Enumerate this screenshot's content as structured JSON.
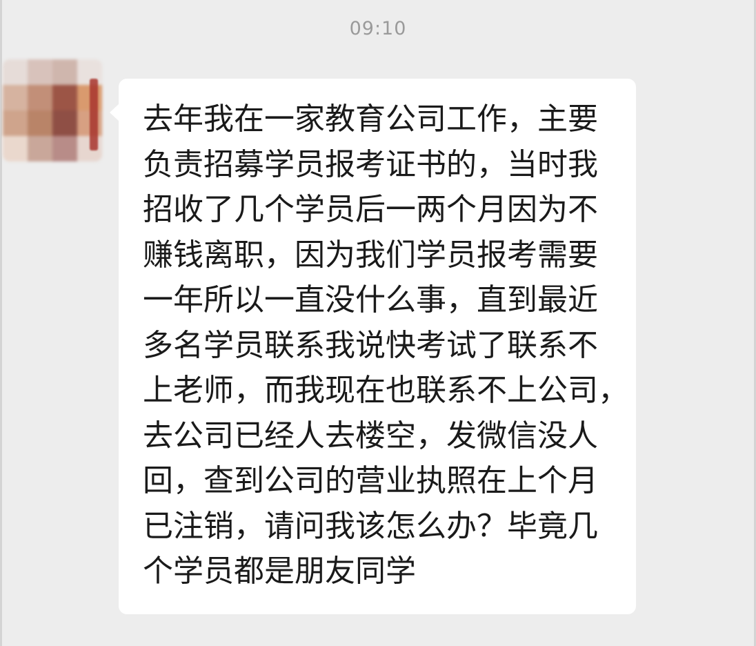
{
  "chat": {
    "timestamp": "09:10",
    "message": {
      "lines": [
        "去年我在一家教育公司工作，主要",
        "负责招募学员报考证书的，当时我",
        "招收了几个学员后一两个月因为不",
        "赚钱离职，因为我们学员报考需要",
        "一年所以一直没什么事，直到最近",
        "多名学员联系我说快考试了联系不",
        "上老师，而我现在也联系不上公司，",
        "去公司已经人去楼空，发微信没人",
        "回，查到公司的营业执照在上个月",
        "已注销，请问我该怎么办？毕竟几",
        "个学员都是朋友同学"
      ]
    },
    "avatar": {
      "icon": "blurred-avatar-icon",
      "mosaic_colors": [
        "#e6dcd8",
        "#d8c2bb",
        "#cfb6ad",
        "#e9e1de",
        "#d6b3a0",
        "#c28f78",
        "#9c5546",
        "#d99a6e",
        "#cfa48c",
        "#b98468",
        "#8f4f45",
        "#d7a082",
        "#ead8cd",
        "#c9a79a",
        "#b88c88",
        "#e7d6cf"
      ]
    }
  }
}
